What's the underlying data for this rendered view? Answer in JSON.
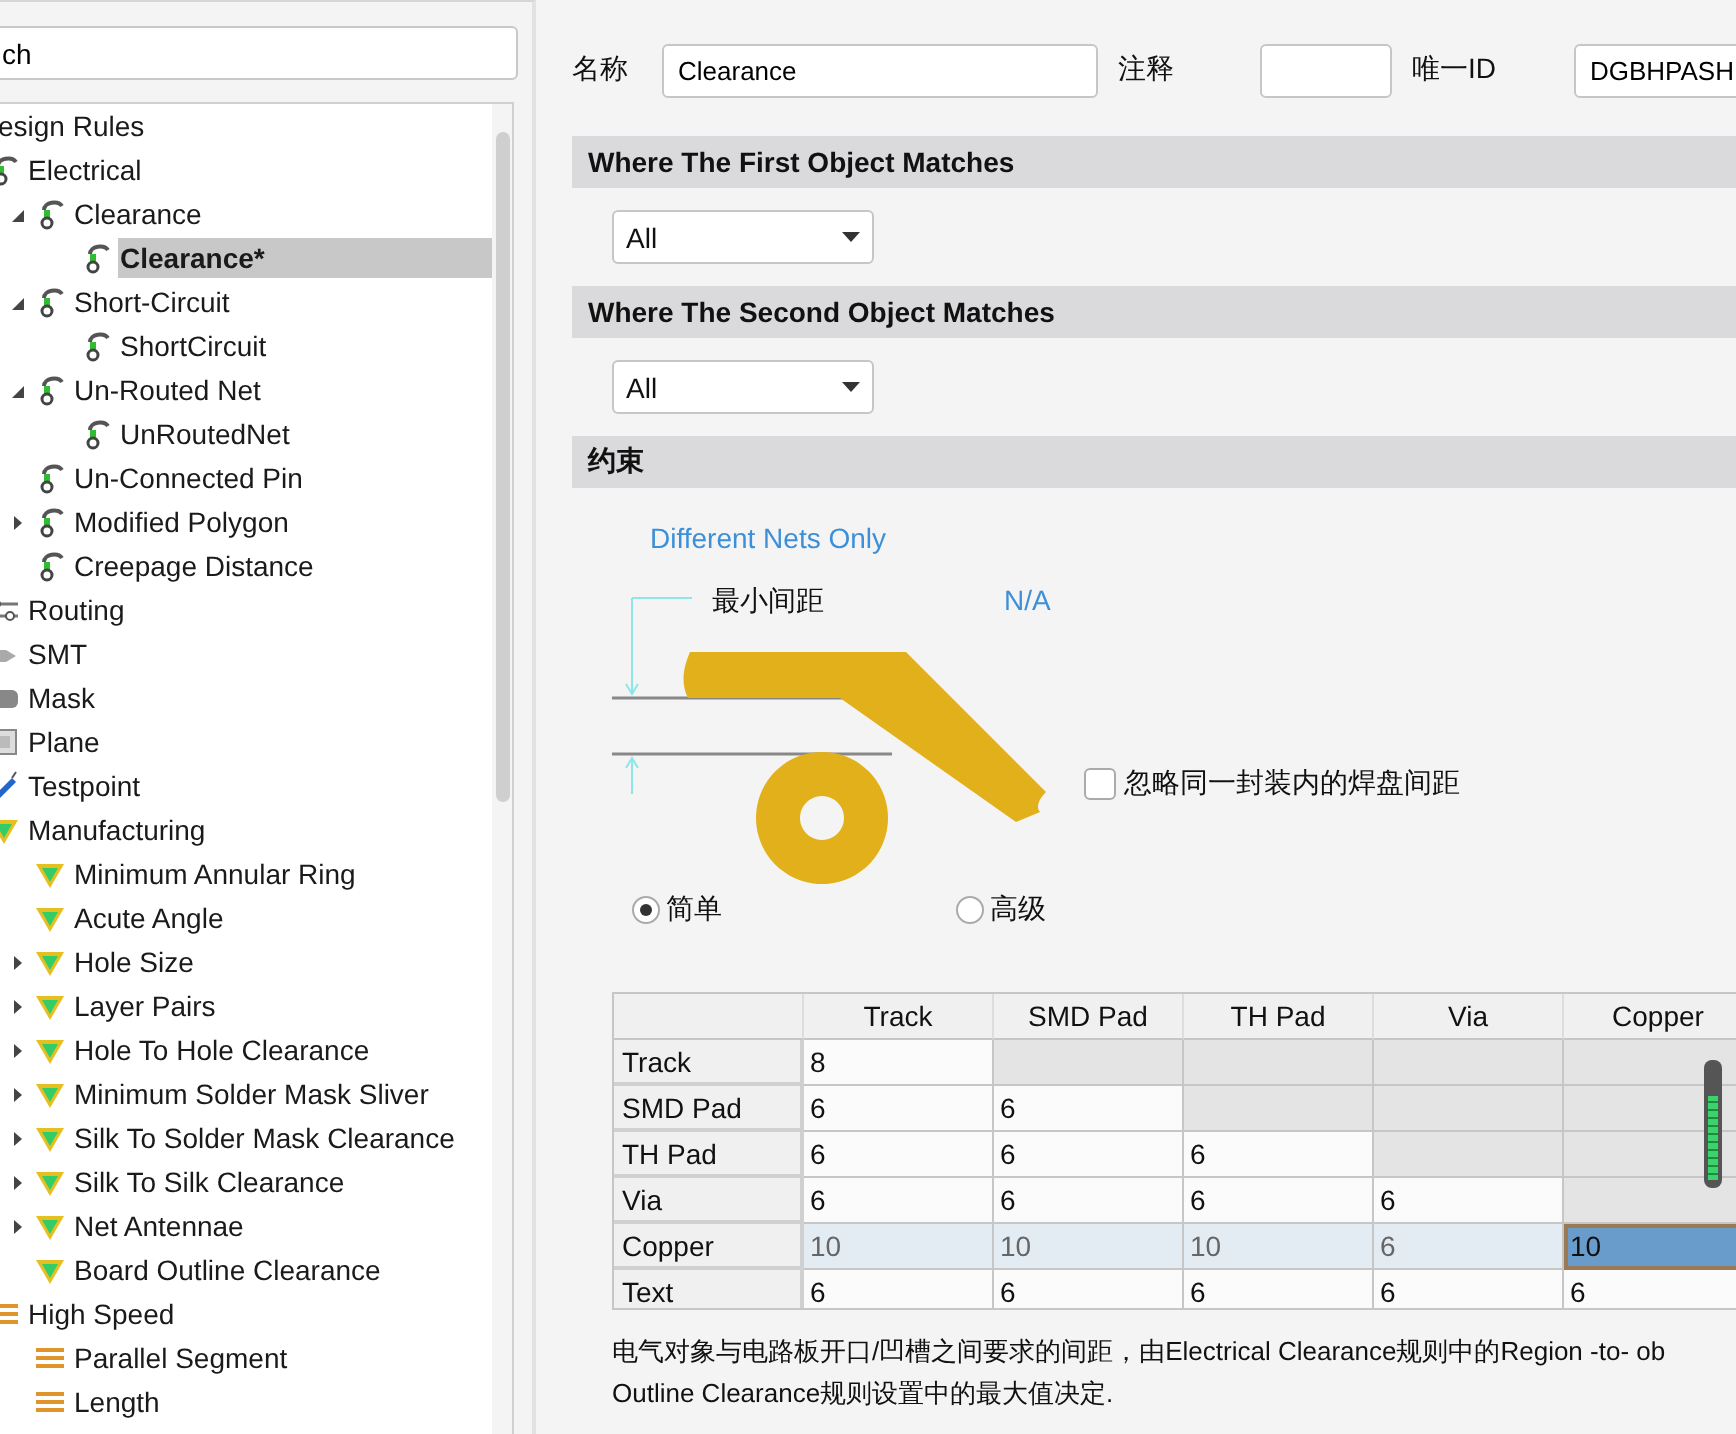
{
  "search": {
    "value": "ch"
  },
  "tree": {
    "label": "esign Rules",
    "children": [
      {
        "label": "Electrical",
        "kind": "electrical",
        "selected": false,
        "children": [
          {
            "label": "Clearance",
            "kind": "electrical",
            "selected": false,
            "expanded": true,
            "children": [
              {
                "label": "Clearance*",
                "kind": "electrical",
                "selected": true
              }
            ]
          },
          {
            "label": "Short-Circuit",
            "kind": "electrical",
            "selected": false,
            "expanded": true,
            "children": [
              {
                "label": "ShortCircuit",
                "kind": "electrical",
                "selected": false
              }
            ]
          },
          {
            "label": "Un-Routed Net",
            "kind": "electrical",
            "selected": false,
            "expanded": true,
            "children": [
              {
                "label": "UnRoutedNet",
                "kind": "electrical",
                "selected": false
              }
            ]
          },
          {
            "label": "Un-Connected Pin",
            "kind": "electrical",
            "selected": false
          },
          {
            "label": "Modified Polygon",
            "kind": "electrical",
            "selected": false,
            "expanded": false
          },
          {
            "label": "Creepage Distance",
            "kind": "electrical",
            "selected": false
          }
        ]
      },
      {
        "label": "Routing",
        "kind": "routing",
        "selected": false
      },
      {
        "label": "SMT",
        "kind": "smt",
        "selected": false
      },
      {
        "label": "Mask",
        "kind": "mask",
        "selected": false
      },
      {
        "label": "Plane",
        "kind": "plane",
        "selected": false
      },
      {
        "label": "Testpoint",
        "kind": "testpoint",
        "selected": false
      },
      {
        "label": "Manufacturing",
        "kind": "manufacturing",
        "selected": false,
        "children": [
          {
            "label": "Minimum Annular Ring",
            "kind": "manufacturing",
            "selected": false
          },
          {
            "label": "Acute Angle",
            "kind": "manufacturing",
            "selected": false
          },
          {
            "label": "Hole Size",
            "kind": "manufacturing",
            "selected": false,
            "expanded": false
          },
          {
            "label": "Layer Pairs",
            "kind": "manufacturing",
            "selected": false,
            "expanded": false
          },
          {
            "label": "Hole To Hole Clearance",
            "kind": "manufacturing",
            "selected": false,
            "expanded": false
          },
          {
            "label": "Minimum Solder Mask Sliver",
            "kind": "manufacturing",
            "selected": false,
            "expanded": false
          },
          {
            "label": "Silk To Solder Mask Clearance",
            "kind": "manufacturing",
            "selected": false,
            "expanded": false
          },
          {
            "label": "Silk To Silk Clearance",
            "kind": "manufacturing",
            "selected": false,
            "expanded": false
          },
          {
            "label": "Net Antennae",
            "kind": "manufacturing",
            "selected": false,
            "expanded": false
          },
          {
            "label": "Board Outline Clearance",
            "kind": "manufacturing",
            "selected": false
          }
        ]
      },
      {
        "label": "High Speed",
        "kind": "high-speed",
        "selected": false,
        "children": [
          {
            "label": "Parallel Segment",
            "kind": "high-speed",
            "selected": false
          },
          {
            "label": "Length",
            "kind": "high-speed",
            "selected": false
          }
        ]
      }
    ]
  },
  "header": {
    "name_label": "名称",
    "name_value": "Clearance",
    "comment_label": "注释",
    "id_label": "唯一ID",
    "id_value": "DGBHPASH"
  },
  "first_match": {
    "title": "Where The First Object Matches",
    "value": "All"
  },
  "second_match": {
    "title": "Where The Second Object Matches",
    "value": "All"
  },
  "constraints": {
    "title": "约束",
    "net_scope": "Different Nets Only",
    "min_clearance_label": "最小间距",
    "min_clearance_value": "N/A",
    "ignore_pads": {
      "label": "忽略同一封装内的焊盘间距",
      "checked": false
    },
    "modes": [
      {
        "label": "简单",
        "selected": true
      },
      {
        "label": "高级",
        "selected": false
      }
    ]
  },
  "table": {
    "columns": [
      "Track",
      "SMD Pad",
      "TH Pad",
      "Via",
      "Copper"
    ],
    "rows": [
      {
        "header": "Track",
        "selected": false,
        "cells": [
          {
            "value": "8",
            "disabled": false,
            "focused": false
          },
          {
            "disabled": true,
            "focused": false
          },
          {
            "disabled": true,
            "focused": false
          },
          {
            "disabled": true,
            "focused": false
          },
          {
            "disabled": true,
            "focused": false
          }
        ]
      },
      {
        "header": "SMD Pad",
        "selected": false,
        "cells": [
          {
            "value": "6",
            "disabled": false,
            "focused": false
          },
          {
            "value": "6",
            "disabled": false,
            "focused": false
          },
          {
            "disabled": true,
            "focused": false
          },
          {
            "disabled": true,
            "focused": false
          },
          {
            "disabled": true,
            "focused": false
          }
        ]
      },
      {
        "header": "TH Pad",
        "selected": false,
        "cells": [
          {
            "value": "6",
            "disabled": false,
            "focused": false
          },
          {
            "value": "6",
            "disabled": false,
            "focused": false
          },
          {
            "value": "6",
            "disabled": false,
            "focused": false
          },
          {
            "disabled": true,
            "focused": false
          },
          {
            "disabled": true,
            "focused": false
          }
        ]
      },
      {
        "header": "Via",
        "selected": false,
        "cells": [
          {
            "value": "6",
            "disabled": false,
            "focused": false
          },
          {
            "value": "6",
            "disabled": false,
            "focused": false
          },
          {
            "value": "6",
            "disabled": false,
            "focused": false
          },
          {
            "value": "6",
            "disabled": false,
            "focused": false
          },
          {
            "disabled": true,
            "focused": false
          }
        ]
      },
      {
        "header": "Copper",
        "selected": true,
        "cells": [
          {
            "value": "10",
            "disabled": false,
            "focused": false
          },
          {
            "value": "10",
            "disabled": false,
            "focused": false
          },
          {
            "value": "10",
            "disabled": false,
            "focused": false
          },
          {
            "value": "6",
            "disabled": false,
            "focused": false
          },
          {
            "value": "10",
            "disabled": false,
            "focused": true
          }
        ]
      },
      {
        "header": "Text",
        "selected": false,
        "cells": [
          {
            "value": "6",
            "disabled": false,
            "focused": false
          },
          {
            "value": "6",
            "disabled": false,
            "focused": false
          },
          {
            "value": "6",
            "disabled": false,
            "focused": false
          },
          {
            "value": "6",
            "disabled": false,
            "focused": false
          },
          {
            "value": "6",
            "disabled": false,
            "focused": false
          }
        ]
      }
    ]
  },
  "description": [
    "电气对象与电路板开口/凹槽之间要求的间距，由Electrical Clearance规则中的Region -to- ob",
    "Outline Clearance规则设置中的最大值决定."
  ]
}
